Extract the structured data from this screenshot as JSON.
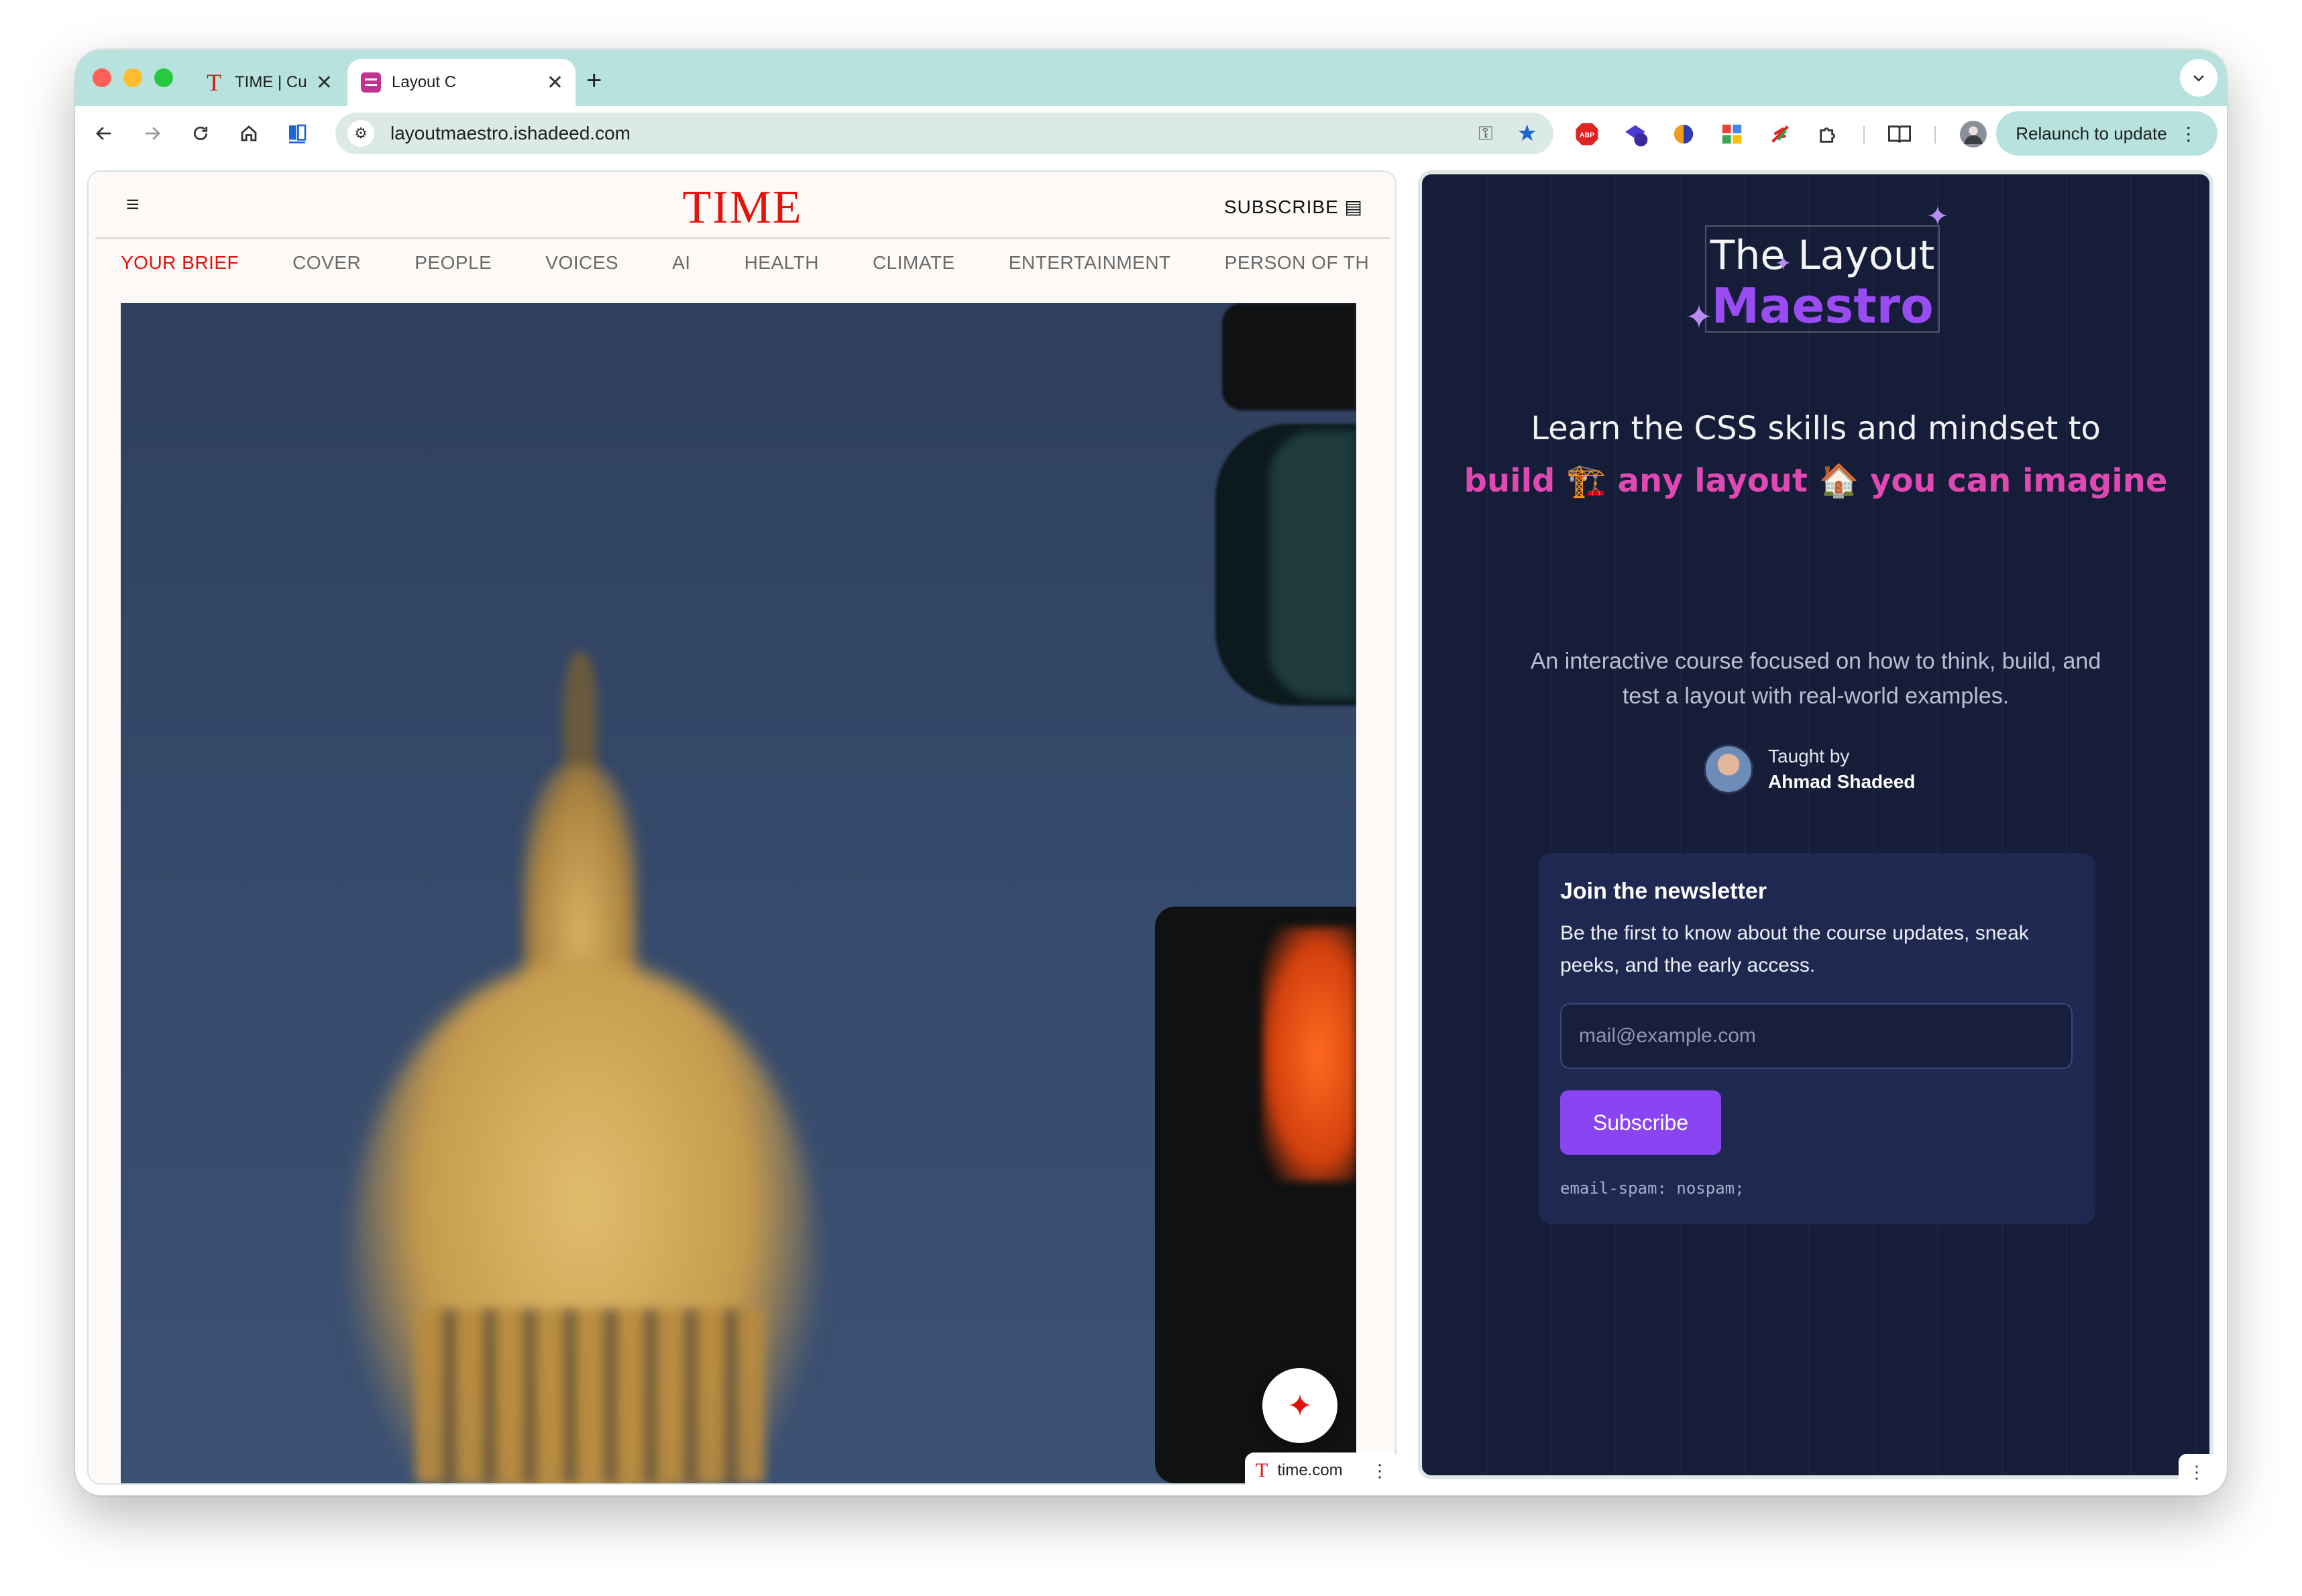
{
  "browser": {
    "tabs": [
      {
        "title": "TIME | Cu",
        "close": "✕"
      },
      {
        "title": "Layout C",
        "close": "✕"
      }
    ],
    "new_tab": "+",
    "tab_search": "⌄",
    "address": "layoutmaestro.ishadeed.com",
    "relaunch_label": "Relaunch to update",
    "menu_dots": "⋮",
    "extensions": [
      "adblock-icon",
      "extension-badge-icon",
      "firefox-like-icon",
      "google-photos-icon",
      "feather-icon",
      "puzzle-icon"
    ],
    "extension_badge_count": "6"
  },
  "time_site": {
    "logo": "TIME",
    "subscribe": "SUBSCRIBE",
    "nav": [
      "YOUR BRIEF",
      "COVER",
      "PEOPLE",
      "VOICES",
      "AI",
      "HEALTH",
      "CLIMATE",
      "ENTERTAINMENT",
      "PERSON OF THE YEAR"
    ],
    "active_nav": "YOUR BRIEF",
    "chip_domain": "time.com"
  },
  "maestro_site": {
    "logo_line1": "The Layout",
    "logo_line2": "Maestro",
    "headline_part1": "Learn the CSS skills and mindset to",
    "headline_build": "build 🏗️ any layout 🏠 you can imagine",
    "lead": "An interactive course focused on how to think, build, and test a layout with real-world examples.",
    "taught_by": "Taught by",
    "author_name": "Ahmad Shadeed",
    "newsletter": {
      "title": "Join the newsletter",
      "description": "Be the first to know about the course updates, sneak peeks, and the early access.",
      "email_placeholder": "mail@example.com",
      "button_label": "Subscribe",
      "footnote": "email-spam: nospam;"
    }
  },
  "colors": {
    "time_red": "#e3120b",
    "maestro_bg": "#161d38",
    "maestro_purple": "#9a4cf3",
    "maestro_pink": "#e049b1",
    "chrome_teal": "#b7e2dd"
  }
}
